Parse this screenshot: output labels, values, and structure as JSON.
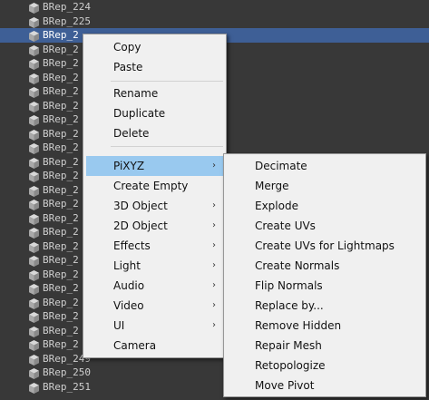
{
  "hierarchy": {
    "rows": [
      {
        "label": "BRep_224"
      },
      {
        "label": "BRep_225"
      },
      {
        "label": "BRep_2",
        "selected": true
      },
      {
        "label": "BRep_2"
      },
      {
        "label": "BRep_2"
      },
      {
        "label": "BRep_2"
      },
      {
        "label": "BRep_2"
      },
      {
        "label": "BRep_2"
      },
      {
        "label": "BRep_2"
      },
      {
        "label": "BRep_2"
      },
      {
        "label": "BRep_2"
      },
      {
        "label": "BRep_2"
      },
      {
        "label": "BRep_2"
      },
      {
        "label": "BRep_2"
      },
      {
        "label": "BRep_2"
      },
      {
        "label": "BRep_2"
      },
      {
        "label": "BRep_2"
      },
      {
        "label": "BRep_2"
      },
      {
        "label": "BRep_2"
      },
      {
        "label": "BRep_2"
      },
      {
        "label": "BRep_2"
      },
      {
        "label": "BRep_2"
      },
      {
        "label": "BRep_2"
      },
      {
        "label": "BRep_2"
      },
      {
        "label": "BRep_2"
      },
      {
        "label": "BRep_249"
      },
      {
        "label": "BRep_250"
      },
      {
        "label": "BRep_251"
      }
    ]
  },
  "context_menu": {
    "copy": "Copy",
    "paste": "Paste",
    "rename": "Rename",
    "duplicate": "Duplicate",
    "delete": "Delete",
    "pixyz": "PiXYZ",
    "create_empty": "Create Empty",
    "object_3d": "3D Object",
    "object_2d": "2D Object",
    "effects": "Effects",
    "light": "Light",
    "audio": "Audio",
    "video": "Video",
    "ui": "UI",
    "camera": "Camera",
    "submenu_arrow": "›"
  },
  "pixyz_submenu": {
    "items": [
      "Decimate",
      "Merge",
      "Explode",
      "Create UVs",
      "Create UVs for Lightmaps",
      "Create Normals",
      "Flip Normals",
      "Replace by...",
      "Remove Hidden",
      "Repair Mesh",
      "Retopologize",
      "Move Pivot"
    ]
  },
  "colors": {
    "panel_bg": "#383838",
    "selection": "#3e5f96",
    "menu_bg": "#f0f0f0",
    "menu_highlight": "#99c9ef"
  },
  "icons": {
    "row_icon": "cube-icon",
    "submenu_indicator": "chevron-right-icon"
  }
}
